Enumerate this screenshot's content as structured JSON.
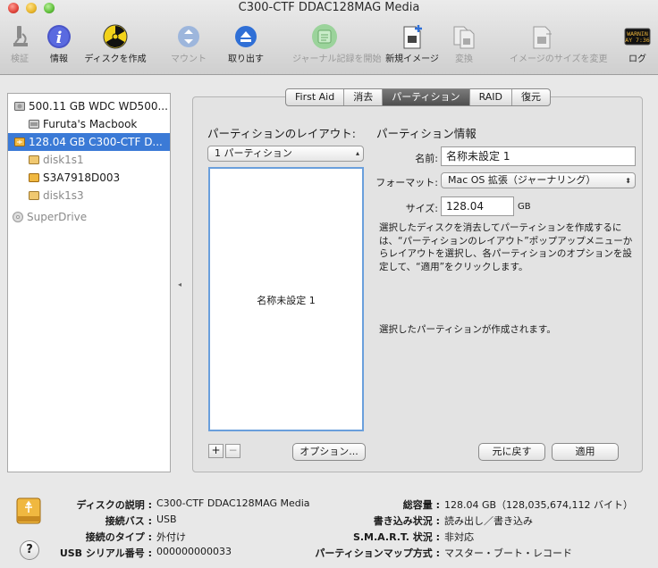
{
  "window": {
    "title": "C300-CTF DDAC128MAG Media"
  },
  "toolbar": [
    {
      "label": "検証",
      "icon": "microscope-icon",
      "disabled": true
    },
    {
      "label": "情報",
      "icon": "info-icon",
      "disabled": false
    },
    {
      "label": "ディスクを作成",
      "icon": "burn-icon",
      "disabled": false
    },
    {
      "label": "マウント",
      "icon": "mount-icon",
      "disabled": true
    },
    {
      "label": "取り出す",
      "icon": "eject-icon",
      "disabled": false
    },
    {
      "label": "ジャーナル記録を開始",
      "icon": "journal-icon",
      "disabled": true
    },
    {
      "label": "新規イメージ",
      "icon": "new-image-icon",
      "disabled": false
    },
    {
      "label": "変換",
      "icon": "convert-icon",
      "disabled": true
    },
    {
      "label": "イメージのサイズを変更",
      "icon": "resize-image-icon",
      "disabled": true
    },
    {
      "label": "ログ",
      "icon": "log-icon",
      "disabled": false
    }
  ],
  "log_icon_text": "WARNIN\nAY 7:36",
  "sidebar": [
    {
      "label": "500.11 GB WDC WD500...",
      "level": 0,
      "kind": "hdd",
      "selected": false,
      "dim": false
    },
    {
      "label": "Furuta's Macbook",
      "level": 1,
      "kind": "volume",
      "selected": false,
      "dim": false
    },
    {
      "label": "128.04 GB C300-CTF D...",
      "level": 0,
      "kind": "usb",
      "selected": true,
      "dim": false
    },
    {
      "label": "disk1s1",
      "level": 1,
      "kind": "usbvol",
      "selected": false,
      "dim": true
    },
    {
      "label": "S3A7918D003",
      "level": 1,
      "kind": "usbvol",
      "selected": false,
      "dim": false
    },
    {
      "label": "disk1s3",
      "level": 1,
      "kind": "usbvol",
      "selected": false,
      "dim": true
    },
    {
      "label": "SuperDrive",
      "level": 0,
      "kind": "optical",
      "selected": false,
      "dim": true
    }
  ],
  "tabs": [
    {
      "label": "First Aid",
      "active": false
    },
    {
      "label": "消去",
      "active": false
    },
    {
      "label": "パーティション",
      "active": true
    },
    {
      "label": "RAID",
      "active": false
    },
    {
      "label": "復元",
      "active": false
    }
  ],
  "partition": {
    "layout_heading": "パーティションのレイアウト:",
    "info_heading": "パーティション情報",
    "layout_popup": "1 パーティション",
    "partition_label": "名称未設定 1",
    "add": "+",
    "remove": "−",
    "options_button": "オプション...",
    "name_label": "名前:",
    "name_value": "名称未設定 1",
    "format_label": "フォーマット:",
    "format_value": "Mac OS 拡張（ジャーナリング）",
    "size_label": "サイズ:",
    "size_value": "128.04",
    "size_unit": "GB",
    "description": "選択したディスクを消去してパーティションを作成するには、“パーティションのレイアウト”ポップアップメニューからレイアウトを選択し、各パーティションのオプションを設定して、“適用”をクリックします。",
    "info": "選択したパーティションが作成されます。",
    "revert_button": "元に戻す",
    "apply_button": "適用"
  },
  "footer": {
    "left": [
      {
        "label": "ディスクの説明 :",
        "value": "C300-CTF DDAC128MAG Media"
      },
      {
        "label": "接続バス :",
        "value": "USB"
      },
      {
        "label": "接続のタイプ :",
        "value": "外付け"
      },
      {
        "label": "USB シリアル番号 :",
        "value": "000000000033"
      }
    ],
    "right": [
      {
        "label": "総容量 :",
        "value": "128.04 GB（128,035,674,112 バイト）"
      },
      {
        "label": "書き込み状況 :",
        "value": "読み出し／書き込み"
      },
      {
        "label": "S.M.A.R.T. 状況 :",
        "value": "非対応"
      },
      {
        "label": "パーティションマップ方式 :",
        "value": "マスター・ブート・レコード"
      }
    ],
    "help": "?"
  }
}
